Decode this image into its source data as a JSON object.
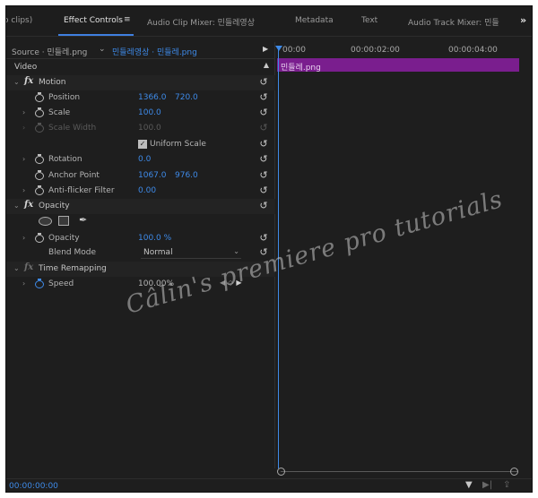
{
  "tabs": {
    "prev_partial": "o clips)",
    "effect_controls": "Effect Controls",
    "menu_glyph": "≡",
    "audio_clip_mixer": "Audio Clip Mixer: 민들레영상",
    "metadata": "Metadata",
    "text": "Text",
    "audio_track_mixer": "Audio Track Mixer: 민들",
    "overflow": "»"
  },
  "source": {
    "label": "Source · 민들레.png",
    "sequence": "민들레영상 · 민들레.png"
  },
  "timeline": {
    "ticks": [
      "00:00",
      "00:00:02:00",
      "00:00:04:00"
    ],
    "clip_label": "민들레.png"
  },
  "video_header": "Video",
  "motion": {
    "label": "Motion",
    "position": {
      "label": "Position",
      "x": "1366.0",
      "y": "720.0"
    },
    "scale": {
      "label": "Scale",
      "value": "100.0"
    },
    "scale_width": {
      "label": "Scale Width",
      "value": "100.0"
    },
    "uniform_scale": {
      "label": "Uniform Scale",
      "checked": "✓"
    },
    "rotation": {
      "label": "Rotation",
      "value": "0.0"
    },
    "anchor_point": {
      "label": "Anchor Point",
      "x": "1067.0",
      "y": "976.0"
    },
    "anti_flicker": {
      "label": "Anti-flicker Filter",
      "value": "0.00"
    }
  },
  "opacity": {
    "label": "Opacity",
    "value_label": "Opacity",
    "value": "100.0 %",
    "blend_mode": {
      "label": "Blend Mode",
      "value": "Normal"
    }
  },
  "time_remapping": {
    "label": "Time Remapping",
    "speed": {
      "label": "Speed",
      "value": "100.00%"
    }
  },
  "footer": {
    "timecode": "00:00:00:00"
  },
  "watermark": "Câlin's premiere pro tutorials",
  "colors": {
    "accent_blue": "#3e8ae8",
    "clip_purple": "#7a1e8e",
    "panel_bg": "#1e1e1e"
  }
}
